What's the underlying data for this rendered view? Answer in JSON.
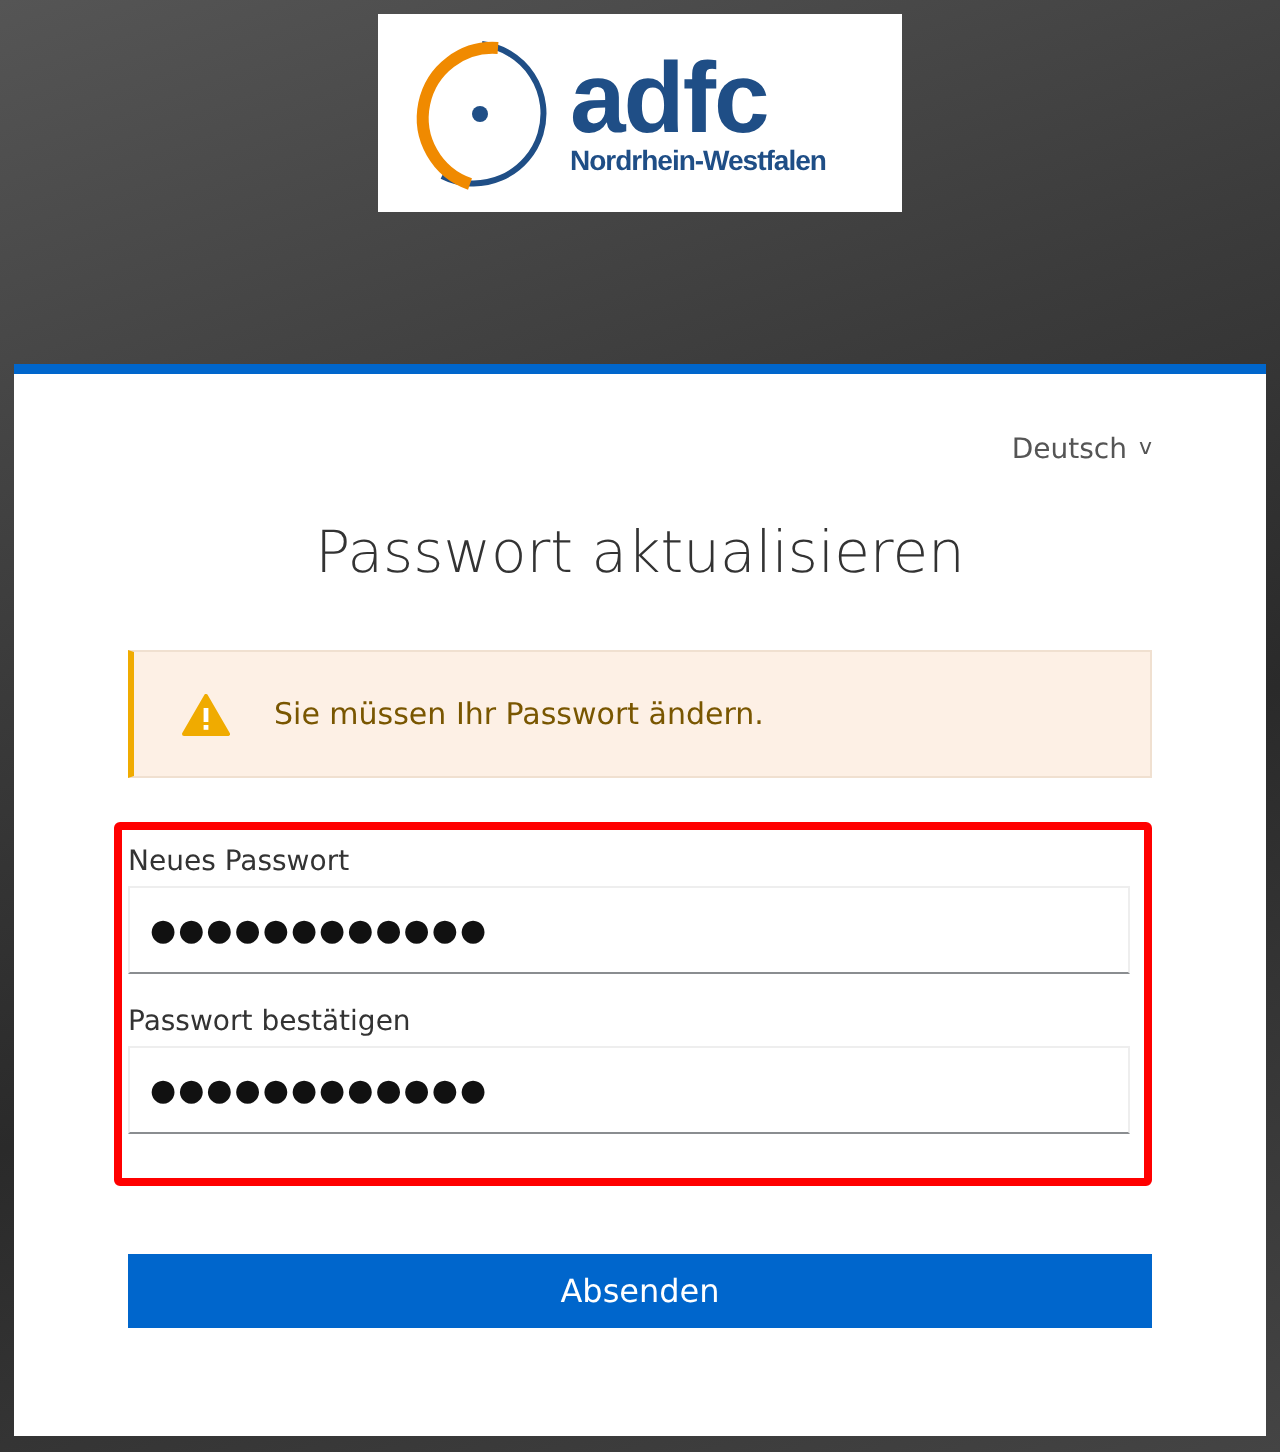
{
  "logo": {
    "wordmark": "adfc",
    "region": "Nordrhein-Westfalen"
  },
  "language": {
    "label": "Deutsch",
    "caret": "v"
  },
  "title": "Passwort aktualisieren",
  "alert": {
    "kind": "warning",
    "message": "Sie müssen Ihr Passwort ändern."
  },
  "highlight": {
    "color": "#ff0000"
  },
  "fields": [
    {
      "label": "Neues Passwort",
      "value": "●●●●●●●●●●●●"
    },
    {
      "label": "Passwort bestätigen",
      "value": "●●●●●●●●●●●●"
    }
  ],
  "submit": "Absenden"
}
